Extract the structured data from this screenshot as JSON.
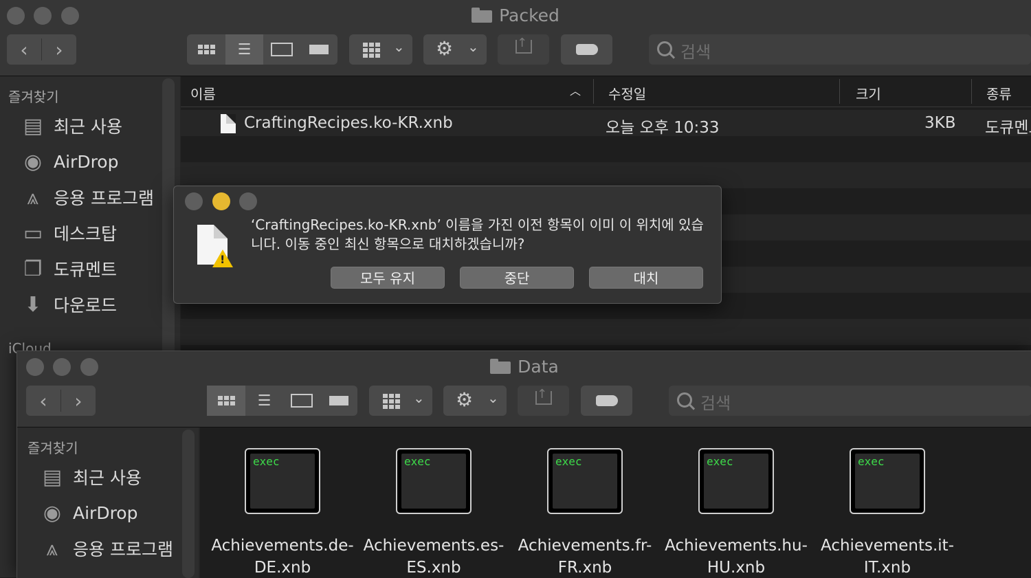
{
  "window1": {
    "title": "Packed",
    "search_placeholder": "검색",
    "sidebar": {
      "favorites_header": "즐겨찾기",
      "items": [
        {
          "label": "최근 사용",
          "icon": "recents-icon"
        },
        {
          "label": "AirDrop",
          "icon": "airdrop-icon"
        },
        {
          "label": "응용 프로그램",
          "icon": "applications-icon"
        },
        {
          "label": "데스크탑",
          "icon": "desktop-icon"
        },
        {
          "label": "도큐멘트",
          "icon": "documents-icon"
        },
        {
          "label": "다운로드",
          "icon": "downloads-icon"
        }
      ],
      "icloud_header": "iCloud"
    },
    "columns": {
      "name": "이름",
      "modified": "수정일",
      "size": "크기",
      "kind": "종류"
    },
    "files": [
      {
        "name": "CraftingRecipes.ko-KR.xnb",
        "modified": "오늘 오후 10:33",
        "size": "3KB",
        "kind": "도큐멘트"
      }
    ]
  },
  "dialog": {
    "message": "‘CraftingRecipes.ko-KR.xnb’ 이름을 가진 이전 항목이 이미 이 위치에 있습니다. 이동 중인 최신 항목으로 대치하겠습니까?",
    "buttons": {
      "keep_both": "모두 유지",
      "stop": "중단",
      "replace": "대치"
    }
  },
  "window2": {
    "title": "Data",
    "search_placeholder": "검색",
    "sidebar": {
      "favorites_header": "즐겨찾기",
      "items": [
        {
          "label": "최근 사용",
          "icon": "recents-icon"
        },
        {
          "label": "AirDrop",
          "icon": "airdrop-icon"
        },
        {
          "label": "응용 프로그램",
          "icon": "applications-icon"
        }
      ]
    },
    "files": [
      {
        "line1": "Achievements.de-",
        "line2": "DE.xnb",
        "badge": "exec"
      },
      {
        "line1": "Achievements.es-",
        "line2": "ES.xnb",
        "badge": "exec"
      },
      {
        "line1": "Achievements.fr-",
        "line2": "FR.xnb",
        "badge": "exec"
      },
      {
        "line1": "Achievements.hu-",
        "line2": "HU.xnb",
        "badge": "exec"
      },
      {
        "line1": "Achievements.it-",
        "line2": "IT.xnb",
        "badge": "exec"
      }
    ]
  }
}
